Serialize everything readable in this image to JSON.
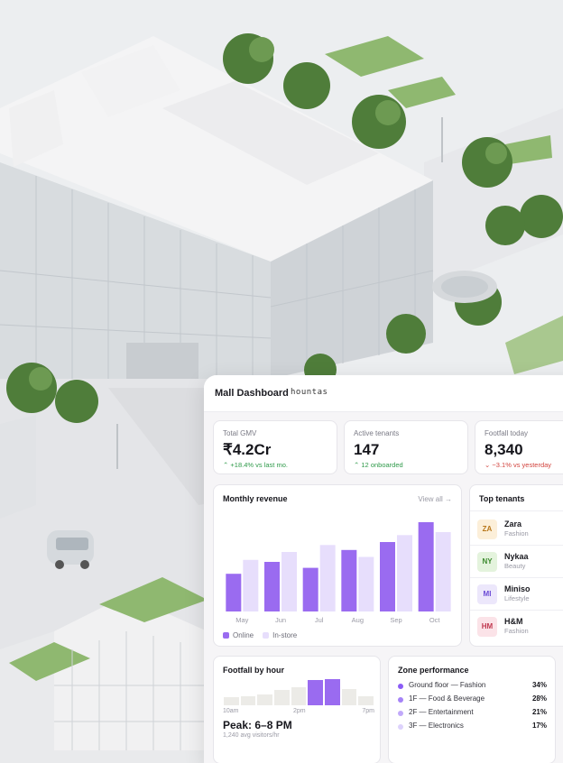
{
  "header": {
    "title": "Mall Dashboard",
    "brand": "hountas"
  },
  "kpis": [
    {
      "label": "Total GMV",
      "value": "₹4.2Cr",
      "delta": "+18.4% vs last mo.",
      "trend": "up"
    },
    {
      "label": "Active tenants",
      "value": "147",
      "delta": "12 onboarded",
      "trend": "up"
    },
    {
      "label": "Footfall today",
      "value": "8,340",
      "delta": "−3.1% vs yesterday",
      "trend": "down"
    }
  ],
  "revenue": {
    "title": "Monthly revenue",
    "view_all": "View all →",
    "legend": {
      "online": "Online",
      "instore": "In-store"
    }
  },
  "top_tenants": {
    "title": "Top tenants",
    "items": [
      {
        "initials": "ZA",
        "name": "Zara",
        "category": "Fashion",
        "bg": "#fcefd9",
        "fg": "#b9781c"
      },
      {
        "initials": "NY",
        "name": "Nykaa",
        "category": "Beauty",
        "bg": "#e4f3dd",
        "fg": "#3c8a2e"
      },
      {
        "initials": "MI",
        "name": "Miniso",
        "category": "Lifestyle",
        "bg": "#ece7fb",
        "fg": "#6b4bd6"
      },
      {
        "initials": "HM",
        "name": "H&M",
        "category": "Fashion",
        "bg": "#fbe3e8",
        "fg": "#c0384f"
      }
    ]
  },
  "footfall": {
    "title": "Footfall by hour",
    "ticks": [
      "10am",
      "2pm",
      "7pm"
    ],
    "peak": "Peak: 6–8 PM",
    "sub": "1,240 avg visitors/hr",
    "levels": [
      0.28,
      0.3,
      0.38,
      0.52,
      0.62,
      0.88,
      0.9,
      0.55,
      0.32
    ],
    "highlight": [
      5,
      6
    ]
  },
  "zones": {
    "title": "Zone performance",
    "items": [
      {
        "name": "Ground floor — Fashion",
        "pct": "34%",
        "color": "#8b5cf6"
      },
      {
        "name": "1F — Food & Beverage",
        "pct": "28%",
        "color": "#a583f7"
      },
      {
        "name": "2F — Entertainment",
        "pct": "21%",
        "color": "#c1a9fa"
      },
      {
        "name": "3F — Electronics",
        "pct": "17%",
        "color": "#ddd2fc"
      }
    ]
  },
  "chart_data": {
    "type": "bar",
    "categories": [
      "Jul",
      "Aug",
      "Sep",
      "Oct"
    ],
    "x_labels": [
      "May",
      "Jun",
      "Jul",
      "Aug",
      "Sep",
      "Oct"
    ],
    "series": [
      {
        "name": "Online",
        "values": [
          38,
          50,
          44,
          62,
          70,
          90
        ]
      },
      {
        "name": "In-store",
        "values": [
          52,
          60,
          67,
          55,
          77,
          80
        ]
      }
    ],
    "ylim": [
      0,
      100
    ],
    "colors": {
      "Online": "#9a6bf0",
      "In-store": "#e7defc"
    },
    "title": "Monthly revenue",
    "legend": "bottom-left",
    "grid": false
  }
}
